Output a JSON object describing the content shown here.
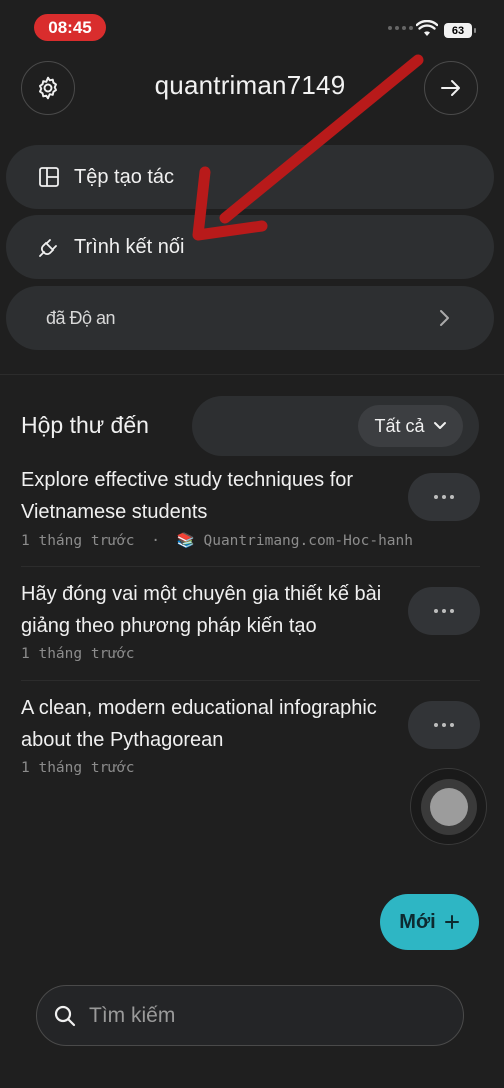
{
  "status_bar": {
    "time": "08:45",
    "battery": "63"
  },
  "header": {
    "username": "quantriman7149"
  },
  "menu": [
    {
      "label": "Tệp tạo tác",
      "icon": "artifacts-icon"
    },
    {
      "label": "Trình kết nối",
      "icon": "plug-icon"
    },
    {
      "label": "đã Độ an",
      "icon": "none",
      "has_chevron": true
    }
  ],
  "inbox": {
    "title": "Hộp thư đến",
    "filter_label": "Tất cả",
    "items": [
      {
        "title": "Explore effective study techniques for Vietnamese students",
        "time": "1 tháng trước",
        "source": "📚 Quantrimang.com-Hoc-hanh"
      },
      {
        "title": "Hãy đóng vai một chuyên gia thiết kế bài giảng theo phương pháp kiến tạo",
        "time": "1 tháng trước"
      },
      {
        "title": "A clean, modern educational infographic about the Pythagorean",
        "time": "1 tháng trước"
      }
    ]
  },
  "new_button": {
    "label": "Mới",
    "icon": "plus-icon"
  },
  "search": {
    "placeholder": "Tìm kiếm",
    "value": ""
  },
  "annotation": {
    "color": "#b81a1a"
  }
}
